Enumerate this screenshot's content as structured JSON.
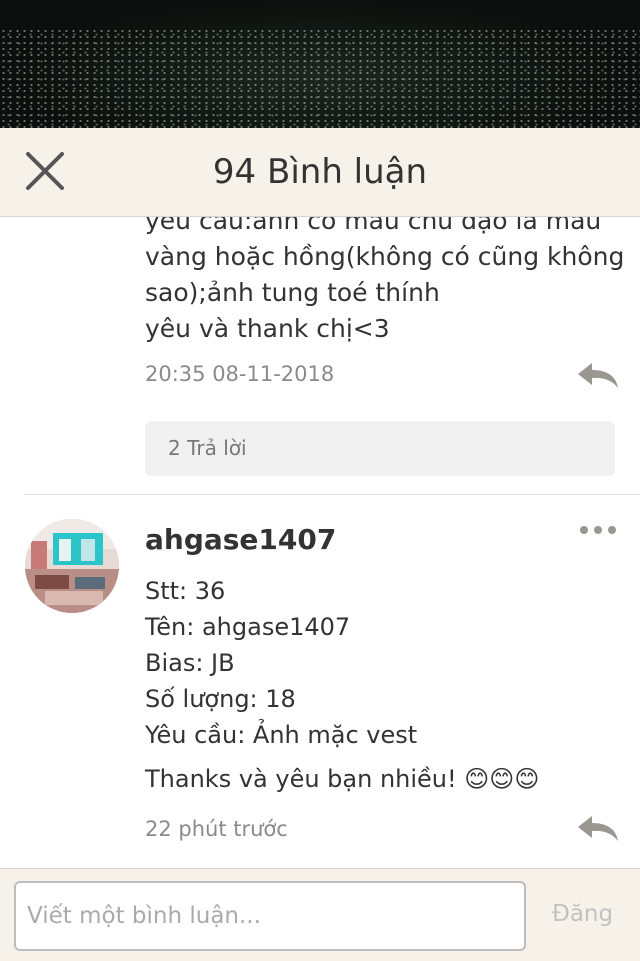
{
  "header": {
    "title": "94 Bình luận",
    "close_icon": "close-icon"
  },
  "previous_comment": {
    "lines": [
      "yêu cầu:ảnh có màu chủ đạo là màu",
      "vàng hoặc hồng(không có cũng không",
      "sao);ảnh tung toé thính",
      "yêu và thank chị<3"
    ],
    "timestamp": "20:35 08-11-2018",
    "replies_label": "2 Trả lời",
    "reply_icon": "reply-arrow-icon"
  },
  "comment": {
    "username": "ahgase1407",
    "more_icon": "more-dots-icon",
    "lines": [
      "Stt: 36",
      "Tên: ahgase1407",
      "Bias: JB",
      "Số lượng: 18",
      "Yêu cầu: Ảnh mặc vest"
    ],
    "thanks_text": "Thanks và yêu bạn nhiều!",
    "emojis": "😊😊😊",
    "timestamp": "22 phút trước",
    "reply_icon": "reply-arrow-icon"
  },
  "composer": {
    "placeholder": "Viết một bình luận...",
    "value": "",
    "post_label": "Đăng"
  },
  "colors": {
    "header_bg": "#f6f2ea",
    "text": "#333333",
    "muted": "#8a8a8a",
    "reply_icon": "#9a9690"
  }
}
